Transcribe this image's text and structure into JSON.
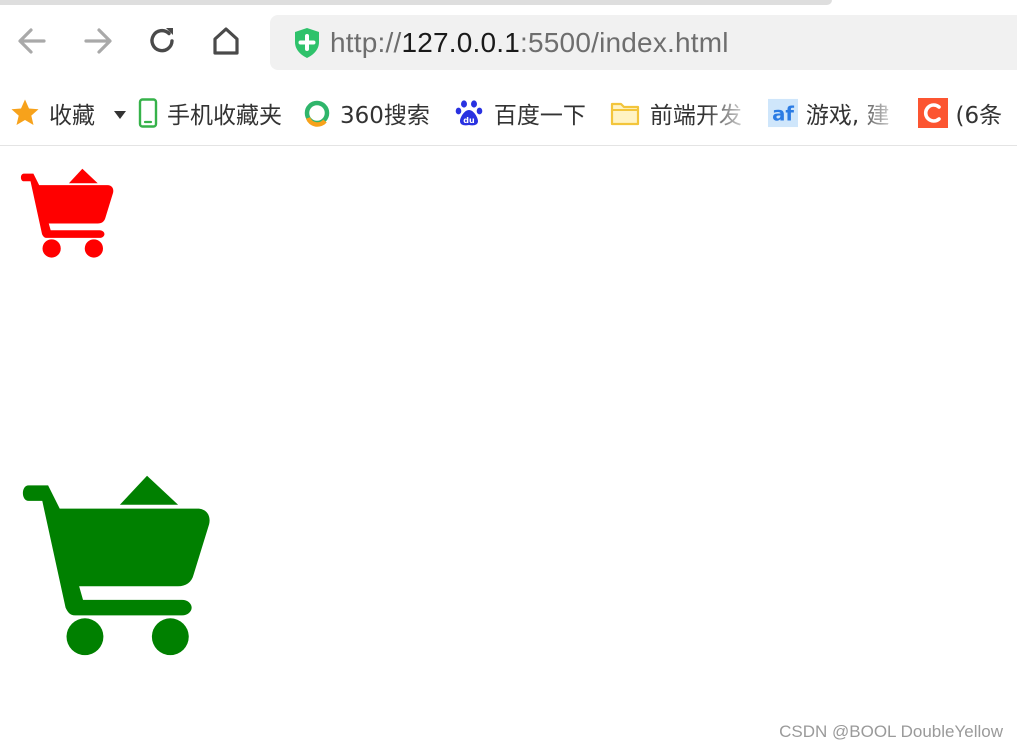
{
  "browser": {
    "url_scheme": "http://",
    "url_host": "127.0.0.1",
    "url_rest": ":5500/index.html"
  },
  "toolbar": {
    "back_icon": "back-arrow-icon",
    "forward_icon": "forward-arrow-icon",
    "reload_icon": "reload-icon",
    "home_icon": "home-icon",
    "security_icon": "shield-plus-icon"
  },
  "bookmarks": [
    {
      "label": "收藏",
      "icon": "star-icon"
    },
    {
      "label": "手机收藏夹",
      "icon": "phone-icon"
    },
    {
      "label": "360搜索",
      "icon": "360-search-icon"
    },
    {
      "label": "百度一下",
      "icon": "baidu-paw-icon"
    },
    {
      "label": "前端开发",
      "icon": "folder-icon"
    },
    {
      "label": "游戏, 建",
      "icon": "af-icon"
    },
    {
      "label": "(6条",
      "icon": "csdn-c-icon"
    }
  ],
  "page": {
    "carts": [
      {
        "icon": "shopping-cart-icon",
        "color": "#ff0000"
      },
      {
        "icon": "shopping-cart-icon",
        "color": "#008000"
      }
    ],
    "watermark": "CSDN @BOOL DoubleYellow"
  },
  "colors": {
    "star": "#f7a21b",
    "phone": "#36b24a",
    "baidu": "#2932e1",
    "folder": "#f3c53b",
    "af_bg": "#cfe6fb",
    "af_text": "#2a7be4",
    "csdn": "#fc5531",
    "shield": "#2fc26b"
  }
}
